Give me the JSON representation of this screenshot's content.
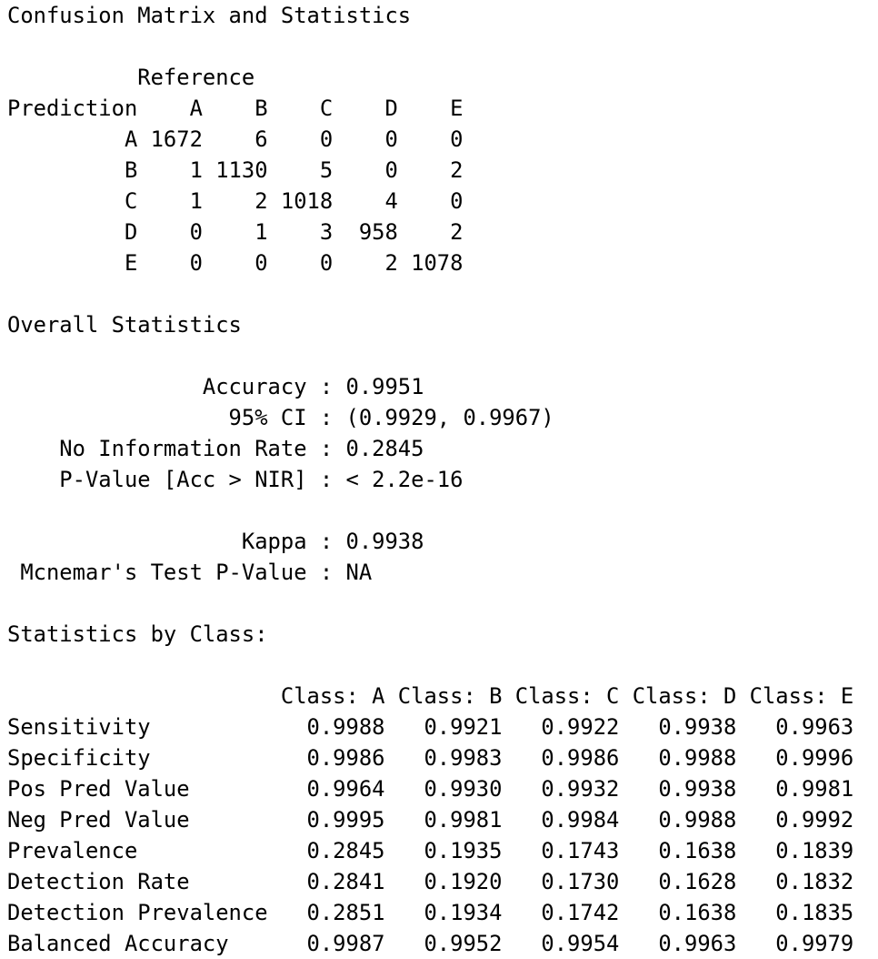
{
  "console": {
    "lines": [
      "Confusion Matrix and Statistics",
      "",
      "          Reference",
      "Prediction    A    B    C    D    E",
      "         A 1672    6    0    0    0",
      "         B    1 1130    5    0    2",
      "         C    1    2 1018    4    0",
      "         D    0    1    3  958    2",
      "         E    0    0    0    2 1078",
      "",
      "Overall Statistics",
      "",
      "               Accuracy : 0.9951",
      "                 95% CI : (0.9929, 0.9967)",
      "    No Information Rate : 0.2845",
      "    P-Value [Acc > NIR] : < 2.2e-16",
      "",
      "                  Kappa : 0.9938",
      " Mcnemar's Test P-Value : NA",
      "",
      "Statistics by Class:",
      "",
      "                     Class: A Class: B Class: C Class: D Class: E",
      "Sensitivity            0.9988   0.9921   0.9922   0.9938   0.9963",
      "Specificity            0.9986   0.9983   0.9986   0.9988   0.9996",
      "Pos Pred Value         0.9964   0.9930   0.9932   0.9938   0.9981",
      "Neg Pred Value         0.9995   0.9981   0.9984   0.9988   0.9992",
      "Prevalence             0.2845   0.1935   0.1743   0.1638   0.1839",
      "Detection Rate         0.2841   0.1920   0.1730   0.1628   0.1832",
      "Detection Prevalence   0.2851   0.1934   0.1742   0.1638   0.1835",
      "Balanced Accuracy      0.9987   0.9952   0.9954   0.9963   0.9979"
    ]
  }
}
